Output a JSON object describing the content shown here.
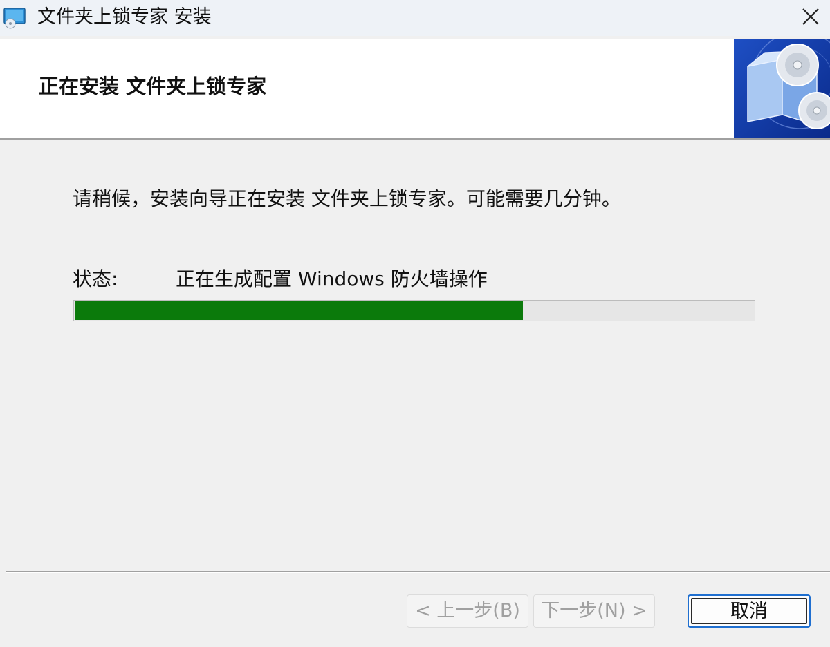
{
  "window": {
    "title": "文件夹上锁专家 安装",
    "app_icon": "installer-cd-icon",
    "close_icon": "close-icon"
  },
  "banner": {
    "title": "正在安装 文件夹上锁专家",
    "image": "installer-disc-box-graphic"
  },
  "body": {
    "message": "请稍候，安装向导正在安装 文件夹上锁专家。可能需要几分钟。",
    "status_label": "状态:",
    "status_value": "正在生成配置 Windows 防火墙操作",
    "progress_fraction": 0.66,
    "progress_color": "#0b7a0b"
  },
  "footer": {
    "back_label": "< 上一步(B)",
    "next_label": "下一步(N) >",
    "cancel_label": "取消",
    "back_enabled": false,
    "next_enabled": false,
    "focus_color": "#1f6fd0"
  }
}
